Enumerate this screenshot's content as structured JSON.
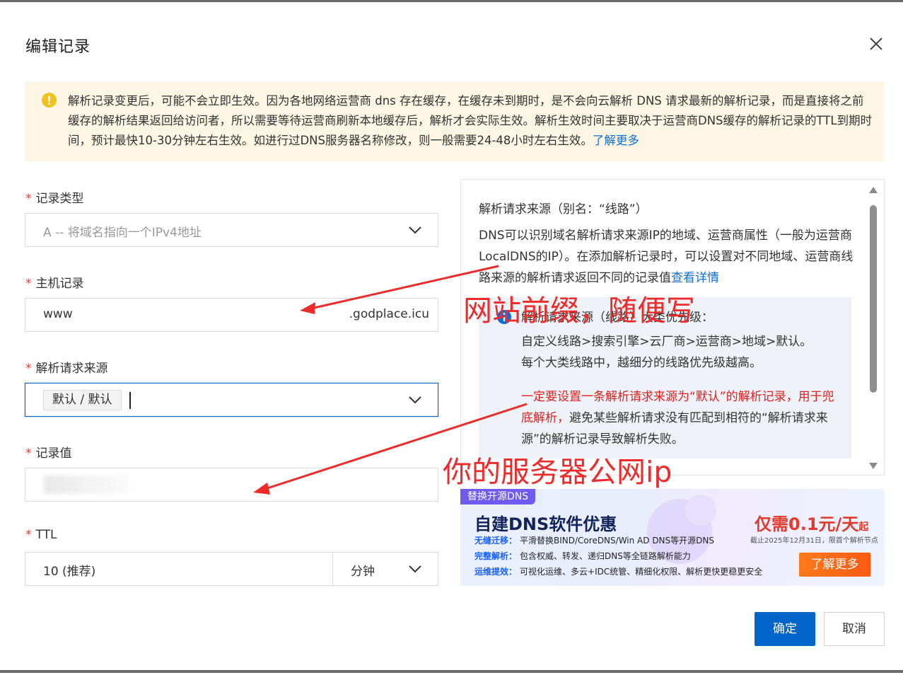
{
  "dialog": {
    "title": "编辑记录",
    "close_icon": "close-icon"
  },
  "notice": {
    "icon": "warning-icon",
    "text": "解析记录变更后，可能不会立即生效。因为各地网络运营商 dns 存在缓存，在缓存未到期时，是不会向云解析 DNS 请求最新的解析记录，而是直接将之前缓存的解析结果返回给访问者，所以需要等待运营商刷新本地缓存后，解析才会实际生效。解析生效时间主要取决于运营商DNS缓存的解析记录的TTL到期时间，预计最快10-30分钟左右生效。如进行过DNS服务器名称修改，则一般需要24-48小时左右生效。",
    "link": "了解更多"
  },
  "form": {
    "record_type": {
      "label": "记录类型",
      "value": "A -- 将域名指向一个IPv4地址"
    },
    "host": {
      "label": "主机记录",
      "value": "www",
      "suffix": ".godplace.icu"
    },
    "line": {
      "label": "解析请求来源",
      "tag": "默认 / 默认"
    },
    "value": {
      "label": "记录值"
    },
    "ttl": {
      "label": "TTL",
      "value": "10 (推荐)",
      "unit": "分钟"
    },
    "required_mark": "*"
  },
  "side_panel": {
    "heading": "解析请求来源（别名：“线路”）",
    "para": "DNS可以识别域名解析请求来源IP的地域、运营商属性（一般为运营商LocalDNS的IP）。在添加解析记录时，可以设置对不同地域、运营商线路来源的解析请求返回不同的记录值",
    "para_link": "查看详情",
    "info_icon": "info-icon",
    "info_title": "解析请求来源（线路）大类优先级：",
    "info_line1": "自定义线路>搜索引擎>云厂商>运营商>地域>默认。",
    "info_line2": "每个大类线路中，越细分的线路优先级越高。",
    "info_red": "一定要设置一条解析请求来源为“默认”的解析记录，用于兜底解析，",
    "info_rest": "避免某些解析请求没有匹配到相符的“解析请求来源”的解析记录导致解析失败。"
  },
  "banner": {
    "tag": "替换开源DNS",
    "title": "自建DNS软件优惠",
    "rows": [
      {
        "key": "无缝迁移：",
        "text": "平滑替换BIND/CoreDNS/Win AD DNS等开源DNS"
      },
      {
        "key": "完整解析：",
        "text": "包含权威、转发、递归DNS等全链路解析能力"
      },
      {
        "key": "运维提效：",
        "text": "可视化运维、多云+IDC统管、精细化权限、解析更快更稳更安全"
      }
    ],
    "price": "仅需0.1元/天",
    "price_suffix": "起",
    "price_sub": "截止2025年12月31日，限首个解析节点",
    "cta": "了解更多"
  },
  "buttons": {
    "ok": "确定",
    "cancel": "取消"
  },
  "annotations": {
    "host_note": "网站前缀，随便写",
    "value_note": "你的服务器公网ip",
    "color": "#ee2b2b"
  },
  "colors": {
    "primary": "#0064c8",
    "link": "#0d6fd6",
    "warning": "#f0c21d",
    "notice_bg": "#fdf6e4"
  }
}
